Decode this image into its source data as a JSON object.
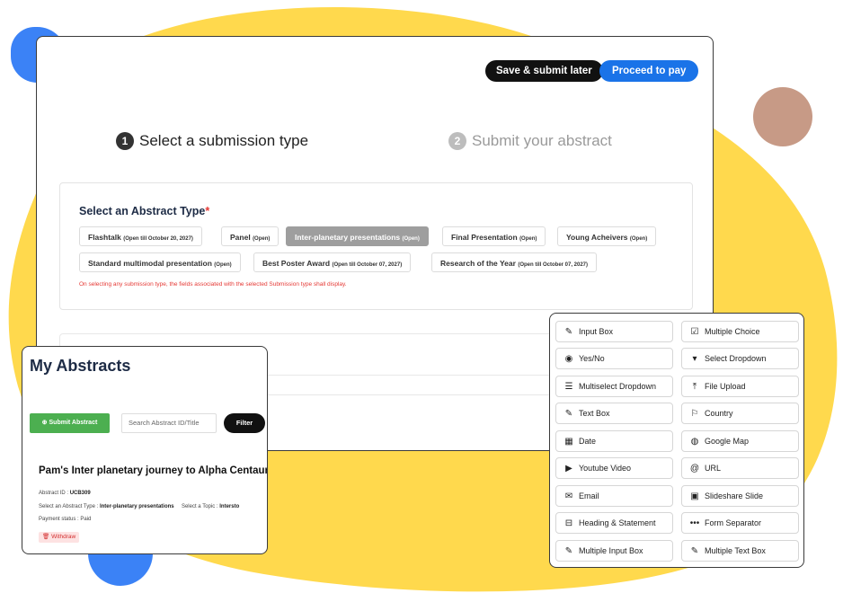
{
  "colors": {
    "yellow": "#ffd94d",
    "blue": "#3b82f6",
    "brown": "#c79a86",
    "accent": "#1a73e8",
    "green": "#4caf50"
  },
  "header": {
    "save_label": "Save & submit later",
    "pay_label": "Proceed to pay"
  },
  "steps": [
    {
      "num": "1",
      "label": "Select a submission type"
    },
    {
      "num": "2",
      "label": "Submit your abstract"
    }
  ],
  "abstract_type": {
    "title": "Select an Abstract Type",
    "required_mark": "*",
    "options": [
      {
        "label": "Flashtalk",
        "status": "(Open till October 20, 2027)"
      },
      {
        "label": "Panel",
        "status": "(Open)"
      },
      {
        "label": "Inter-planetary presentations",
        "status": "(Open)",
        "selected": true
      },
      {
        "label": "Final Presentation",
        "status": "(Open)"
      },
      {
        "label": "Young Acheivers",
        "status": "(Open)"
      },
      {
        "label": "Standard multimodal presentation",
        "status": "(Open)"
      },
      {
        "label": "Best Poster Award",
        "status": "(Open till October 07, 2027)"
      },
      {
        "label": "Research of the Year",
        "status": "(Open till October 07, 2027)"
      }
    ],
    "note": "On selecting any submission type, the fields associated with the selected Submission type shall display."
  },
  "my_abstracts": {
    "title": "My Abstracts",
    "submit_label": "Submit Abstract",
    "search_placeholder": "Search Abstract ID/Title",
    "filter_label": "Filter",
    "item": {
      "title": "Pam's Inter planetary journey to Alpha Centauri",
      "id_label": "Abstract ID :",
      "id_value": "UCB309",
      "type_label": "Select an Abstract Type :",
      "type_value": "Inter-planetary presentations",
      "topic_label": "Select a Topic :",
      "topic_value": "Intersto",
      "payment_label": "Payment status :",
      "payment_value": "Paid",
      "withdraw_label": "Withdraw"
    }
  },
  "field_types": [
    {
      "label": "Input Box",
      "icon": "edit-icon"
    },
    {
      "label": "Multiple Choice",
      "icon": "checkbox-icon"
    },
    {
      "label": "Yes/No",
      "icon": "radio-icon"
    },
    {
      "label": "Select Dropdown",
      "icon": "caret-down-icon"
    },
    {
      "label": "Multiselect Dropdown",
      "icon": "list-icon"
    },
    {
      "label": "File Upload",
      "icon": "upload-icon"
    },
    {
      "label": "Text Box",
      "icon": "edit-icon"
    },
    {
      "label": "Country",
      "icon": "flag-icon"
    },
    {
      "label": "Date",
      "icon": "calendar-icon"
    },
    {
      "label": "Google Map",
      "icon": "globe-icon"
    },
    {
      "label": "Youtube Video",
      "icon": "youtube-icon"
    },
    {
      "label": "URL",
      "icon": "at-icon"
    },
    {
      "label": "Email",
      "icon": "envelope-icon"
    },
    {
      "label": "Slideshare Slide",
      "icon": "slideshare-icon"
    },
    {
      "label": "Heading & Statement",
      "icon": "minus-square-icon"
    },
    {
      "label": "Form Separator",
      "icon": "ellipsis-icon"
    },
    {
      "label": "Multiple Input Box",
      "icon": "edit-icon"
    },
    {
      "label": "Multiple Text Box",
      "icon": "edit-icon"
    }
  ]
}
